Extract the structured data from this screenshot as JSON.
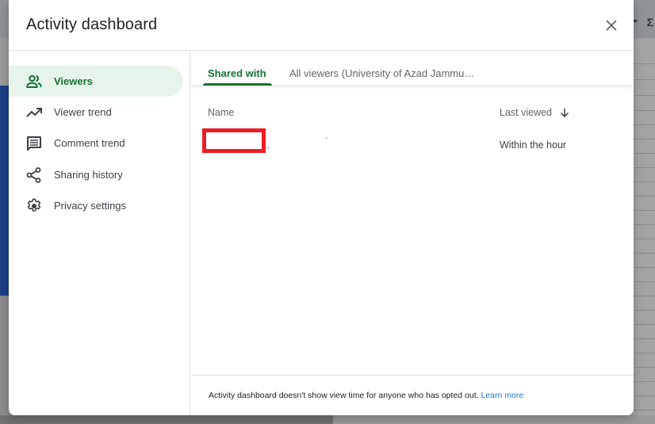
{
  "dialog": {
    "title": "Activity dashboard"
  },
  "sidebar": {
    "items": [
      {
        "label": "Viewers",
        "icon": "people-icon",
        "active": true
      },
      {
        "label": "Viewer trend",
        "icon": "trending-up-icon",
        "active": false
      },
      {
        "label": "Comment trend",
        "icon": "comment-icon",
        "active": false
      },
      {
        "label": "Sharing history",
        "icon": "share-icon",
        "active": false
      },
      {
        "label": "Privacy settings",
        "icon": "gear-icon",
        "active": false
      }
    ]
  },
  "tabs": [
    {
      "label": "Shared with",
      "active": true
    },
    {
      "label": "All viewers (University of Azad Jammu…",
      "active": false
    }
  ],
  "table": {
    "columns": [
      "Name",
      "Last viewed"
    ],
    "sort": "descending",
    "rows": [
      {
        "name": "[redacted]",
        "last_viewed": "Within the hour"
      }
    ]
  },
  "footer": {
    "text": "Activity dashboard doesn't show view time for anyone who has opted out.",
    "link": "Learn more"
  },
  "colors": {
    "accent": "#137333",
    "active_bg": "#e6f4ea",
    "link": "#1a73e8",
    "redaction": "#ed1c24"
  }
}
